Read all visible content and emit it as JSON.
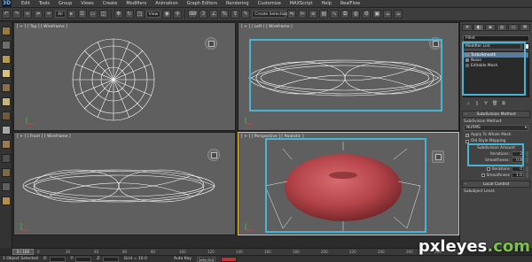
{
  "menubar": {
    "app_icon": "3D",
    "items": [
      "Edit",
      "Tools",
      "Group",
      "Views",
      "Create",
      "Modifiers",
      "Animation",
      "Graph Editors",
      "Rendering",
      "Customize",
      "MAXScript",
      "Help",
      "RealFlow"
    ]
  },
  "toolbar": {
    "filter_value": "All",
    "view_value": "View",
    "selection_set_placeholder": "Create Selection Se"
  },
  "viewports": {
    "top": {
      "label": "[ + ] [ Top ] [ Wireframe ]"
    },
    "left": {
      "label": "[ + ] [ Left ] [ Wireframe ]"
    },
    "front": {
      "label": "[ + ] [ Front ] [ Wireframe ]"
    },
    "perspective": {
      "label": "[ + ] [ Perspective ] [ Realistic ]"
    }
  },
  "command_panel": {
    "object_name": "Pillet",
    "modifier_list_label": "Modifier List",
    "stack": [
      {
        "label": "TurboSmooth",
        "selected": true
      },
      {
        "label": "Noise",
        "selected": false
      },
      {
        "label": "Editable Mesh",
        "selected": false
      }
    ],
    "subdivision_method": {
      "rollout_title": "Subdivision Method",
      "label": "Subdivision Method:",
      "value": "NURMS",
      "apply_to_whole_mesh": "Apply To Whole Mesh",
      "old_style_mapping": "Old Style Mapping"
    },
    "subdivision_amount": {
      "title": "Subdivision Amount",
      "iterations_label": "Iterations:",
      "iterations_value": "2",
      "smoothness_label": "Smoothness:",
      "smoothness_value": "0.8",
      "render_iterations_label": "Iterations",
      "render_iterations_value": "0",
      "render_smoothness_label": "Smoothness",
      "render_smoothness_value": "1.0"
    },
    "local_control": {
      "rollout_title": "Local Control",
      "subobject_level_label": "Subobject Level:"
    }
  },
  "timeline": {
    "slider_label": "0 / 100",
    "ticks": [
      "0",
      "20",
      "40",
      "60",
      "80",
      "100",
      "120",
      "140",
      "160",
      "180",
      "200",
      "220",
      "240",
      "260",
      "280"
    ]
  },
  "statusbar": {
    "selection_text": "1 Object Selected",
    "x_label": "X:",
    "y_label": "Y:",
    "z_label": "Z:",
    "grid_text": "Grid = 10.0",
    "auto_key": "Auto Key",
    "selected": "Selected"
  },
  "watermark": {
    "main": "pxleyes",
    "tld": ".com"
  },
  "colors": {
    "highlight_frame": "#47b4d6",
    "torus_red": "#b5454a",
    "viewport_bg": "#5f5f5f"
  }
}
